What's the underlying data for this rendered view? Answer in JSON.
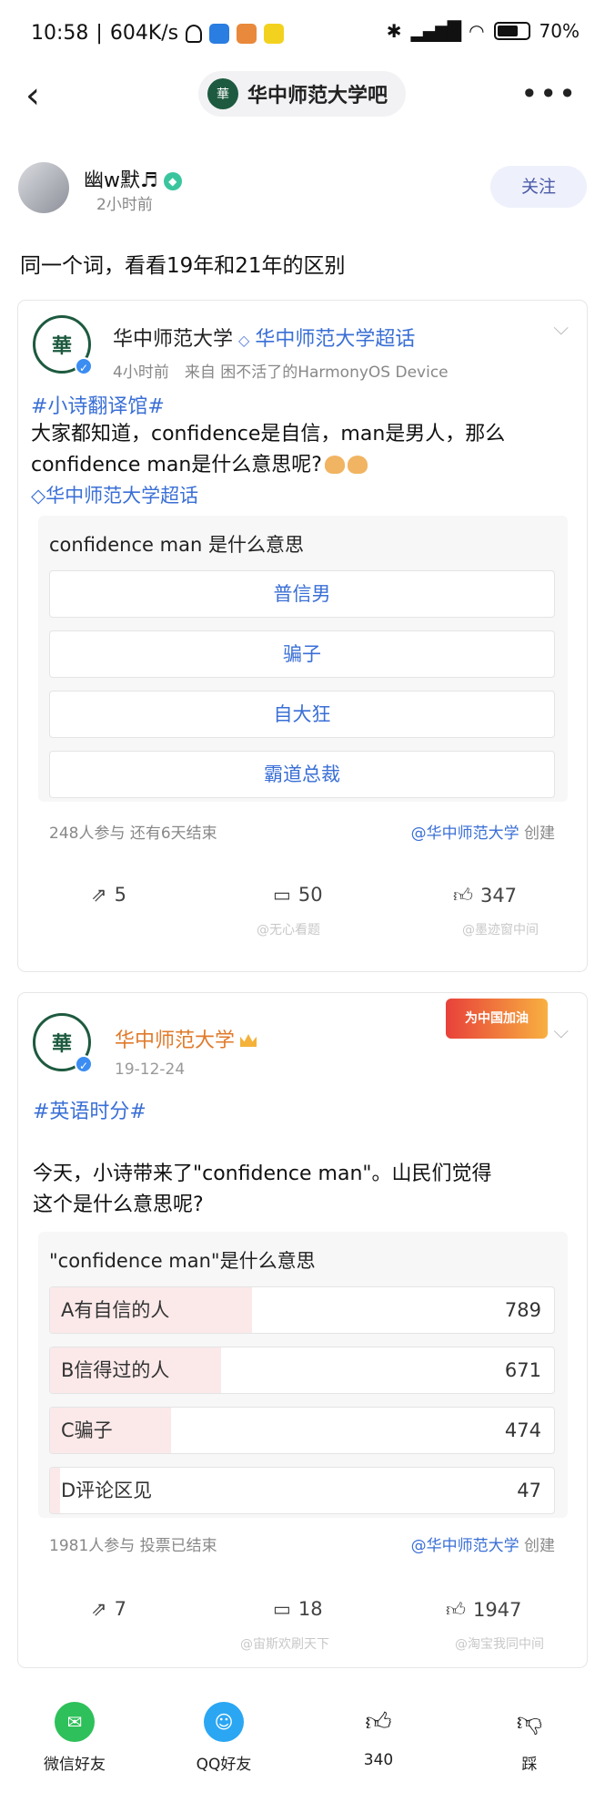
{
  "status_bar": {
    "time": "10:58",
    "speed": "604K/s",
    "battery": "70%",
    "battery_level": 0.7
  },
  "nav": {
    "forum_name": "华中师范大学吧",
    "forum_logo_text": "華"
  },
  "post": {
    "username": "幽w默♬",
    "time": "2小时前",
    "follow_label": "关注",
    "title": "同一个词，看看19年和21年的区别"
  },
  "card1": {
    "logo_text": "華",
    "name": "华中师范大学",
    "topic": "华中师范大学超话",
    "meta": "4小时前　来自 困不活了的HarmonyOS Device",
    "hashtag": "#小诗翻译馆#",
    "text_line1": "大家都知道，confidence是自信，man是男人，那么",
    "text_line2": "confidence man是什么意思呢?",
    "topic_link": "华中师范大学超话",
    "poll_question": "confidence man 是什么意思",
    "options": [
      "普信男",
      "骗子",
      "自大狂",
      "霸道总裁"
    ],
    "poll_footer_left": "248人参与  还有6天结束",
    "poll_footer_at": "@华中师范大学",
    "poll_footer_suffix": " 创建",
    "shares": "5",
    "comments": "50",
    "likes": "347",
    "watermark_left": "@无心看题",
    "watermark_right": "@墨迹窗中间"
  },
  "card2": {
    "logo_text": "華",
    "name": "华中师范大学",
    "date": "19-12-24",
    "banner": "为中国加油",
    "hashtag": "#英语时分#",
    "text_line1": "今天，小诗带来了\"confidence man\"。山民们觉得",
    "text_line2": "这个是什么意思呢?",
    "poll_question": "\"confidence man\"是什么意思",
    "results": [
      {
        "label": "A有自信的人",
        "count": "789",
        "share": 0.4
      },
      {
        "label": "B信得过的人",
        "count": "671",
        "share": 0.34
      },
      {
        "label": "C骗子",
        "count": "474",
        "share": 0.24
      },
      {
        "label": "D评论区见",
        "count": "47",
        "share": 0.02
      }
    ],
    "poll_footer_left": "1981人参与  投票已结束",
    "poll_footer_at": "@华中师范大学",
    "poll_footer_suffix": " 创建",
    "shares": "7",
    "comments": "18",
    "likes": "1947",
    "watermark_left": "@宙斯欢刷天下",
    "watermark_right": "@淘宝我同中间"
  },
  "share_bar": {
    "wechat": "微信好友",
    "qq": "QQ好友",
    "likes": "340",
    "dislike": "踩"
  },
  "colors": {
    "link_blue": "#3a6fd6",
    "hua_green": "#1d5a3f",
    "wechat_green": "#2ec05a",
    "qq_blue": "#2aa6f3"
  }
}
